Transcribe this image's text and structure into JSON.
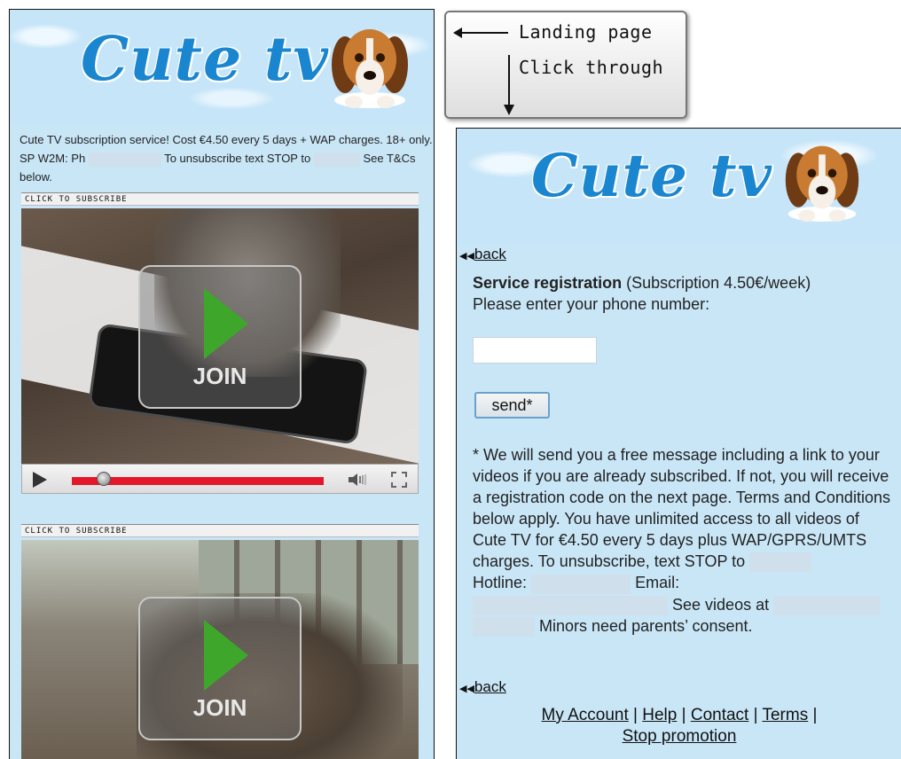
{
  "landing": {
    "logo_text": "Cute tv",
    "intro_parts": [
      "Cute TV subscription service! Cost €4.50 every 5 days + WAP charges. 18+ only. SP W2M: Ph",
      "To unsubscribe text STOP to",
      "See T&Cs below."
    ],
    "subscribe_label": "CLICK TO SUBSCRIBE",
    "join_label": "JOIN"
  },
  "annotation": {
    "landing_label": "Landing page",
    "click_label": "Click through"
  },
  "registration": {
    "logo_text": "Cute tv",
    "back_label": "back",
    "title": "Service registration",
    "subscription_note": "(Subscription 4.50€/week)",
    "prompt": "Please enter your phone number:",
    "phone_value": "",
    "send_label": "send*",
    "terms_text": "* We will send you a free message including a link to your videos if you are already subscribed. If not, you will receive a registration code on the next page. Terms and Conditions below apply. You have unlimited access to all videos of Cute TV for €4.50 every 5 days plus WAP/GPRS/UMTS charges. To unsubscribe, text STOP to",
    "hotline_label": "Hotline:",
    "email_label": "Email:",
    "see_videos_label": "See videos at",
    "minors_text": "Minors need parents’ consent.",
    "footer_links": [
      "My Account",
      "Help",
      "Contact",
      "Terms"
    ],
    "stop_label": "Stop promotion"
  },
  "colors": {
    "accent": "#1a86cf",
    "page_bg": "#c9e6f7",
    "progress": "#e3192b",
    "play": "#3fa62c"
  }
}
